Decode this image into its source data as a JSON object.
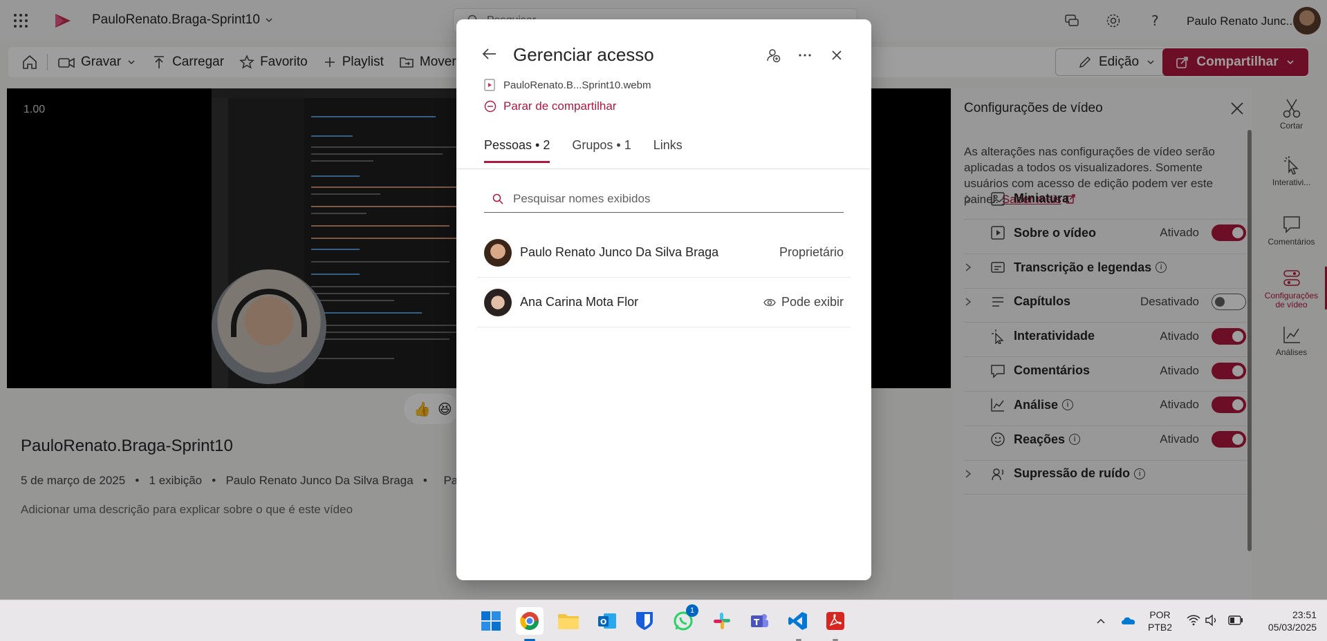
{
  "header": {
    "app_title": "PauloRenato.Braga-Sprint10",
    "search_placeholder": "Pesquisar",
    "user_name": "Paulo Renato Junc..."
  },
  "toolbar": {
    "home_label": "",
    "record_label": "Gravar",
    "upload_label": "Carregar",
    "favorite_label": "Favorito",
    "playlist_label": "Playlist",
    "move_label": "Mover pa",
    "edit_label": "Edição",
    "share_label": "Compartilhar"
  },
  "video": {
    "speed": "1.00",
    "title": "PauloRenato.Braga-Sprint10",
    "date": "5 de março de 2025",
    "views": "1 exibição",
    "author": "Paulo Renato Junco Da Silva Braga",
    "author_extra": "Pau",
    "description_placeholder": "Adicionar uma descrição para explicar sobre o que é este vídeo"
  },
  "settings_panel": {
    "title": "Configurações de vídeo",
    "intro": "As alterações nas configurações de vídeo serão aplicadas a todos os visualizadores. Somente usuários com acesso de edição podem ver este painel.",
    "learn_more": "Saber mais",
    "rows": [
      {
        "label": "Miniatura",
        "status": "",
        "expandable": true,
        "toggle": null,
        "info": false,
        "icon": "image-icon"
      },
      {
        "label": "Sobre o vídeo",
        "status": "Ativado",
        "expandable": false,
        "toggle": "on",
        "info": false,
        "icon": "video-icon"
      },
      {
        "label": "Transcrição e legendas",
        "status": "",
        "expandable": true,
        "toggle": null,
        "info": true,
        "icon": "captions-icon"
      },
      {
        "label": "Capítulos",
        "status": "Desativado",
        "expandable": true,
        "toggle": "off",
        "info": false,
        "icon": "chapters-icon"
      },
      {
        "label": "Interatividade",
        "status": "Ativado",
        "expandable": false,
        "toggle": "on",
        "info": false,
        "icon": "cursor-icon"
      },
      {
        "label": "Comentários",
        "status": "Ativado",
        "expandable": false,
        "toggle": "on",
        "info": false,
        "icon": "comment-icon"
      },
      {
        "label": "Análise",
        "status": "Ativado",
        "expandable": false,
        "toggle": "on",
        "info": true,
        "icon": "chart-icon"
      },
      {
        "label": "Reações",
        "status": "Ativado",
        "expandable": false,
        "toggle": "on",
        "info": true,
        "icon": "emoji-icon"
      },
      {
        "label": "Supressão de ruído",
        "status": "",
        "expandable": true,
        "toggle": null,
        "info": true,
        "icon": "noise-icon"
      }
    ]
  },
  "rail": [
    {
      "label": "Cortar",
      "icon": "scissors-icon",
      "active": false
    },
    {
      "label": "Interativi...",
      "icon": "cursor-icon",
      "active": false
    },
    {
      "label": "Comentários",
      "icon": "comment-icon",
      "active": false
    },
    {
      "label": "Configurações de vídeo",
      "icon": "settings-icon",
      "active": true
    },
    {
      "label": "Análises",
      "icon": "chart-icon",
      "active": false
    }
  ],
  "dialog": {
    "title": "Gerenciar acesso",
    "file_name": "PauloRenato.B...Sprint10.webm",
    "stop_sharing": "Parar de compartilhar",
    "tabs": [
      "Pessoas • 2",
      "Grupos • 1",
      "Links"
    ],
    "search_placeholder": "Pesquisar nomes exibidos",
    "people": [
      {
        "name": "Paulo Renato Junco Da Silva Braga",
        "role": "Proprietário",
        "role_icon": false
      },
      {
        "name": "Ana Carina Mota Flor",
        "role": "Pode exibir",
        "role_icon": true
      }
    ]
  },
  "taskbar": {
    "whatsapp_badge": "1",
    "language": "POR",
    "layout": "PTB2",
    "time": "23:51",
    "date": "05/03/2025"
  },
  "colors": {
    "accent": "#b0173f"
  }
}
